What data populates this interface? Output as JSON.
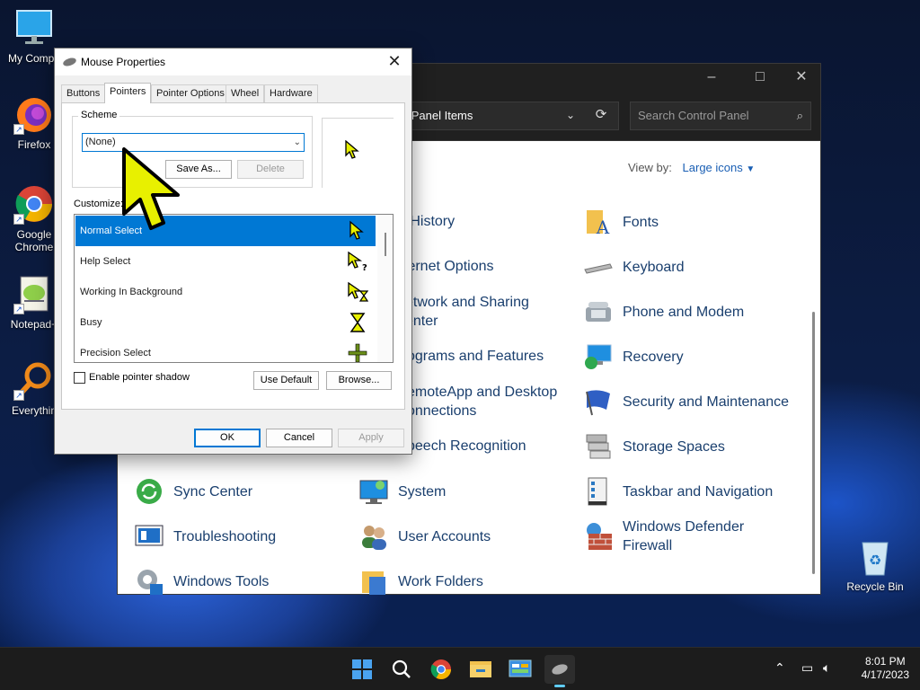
{
  "desktop": {
    "icons": [
      {
        "label": "My Compu"
      },
      {
        "label": "Firefox"
      },
      {
        "label": "Google"
      },
      {
        "label": "Chrome"
      },
      {
        "label": "Notepad+"
      },
      {
        "label": "Everythin"
      },
      {
        "label": "Recycle Bin"
      }
    ]
  },
  "control_panel": {
    "address": "ol Panel Items",
    "search_placeholder": "Search Control Panel",
    "view_by_label": "View by:",
    "view_by_value": "Large icons",
    "items": [
      {
        "label": "e History"
      },
      {
        "label": "Fonts"
      },
      {
        "label": "ternet Options"
      },
      {
        "label": "Keyboard"
      },
      {
        "label": "etwork and Sharing",
        "label2": "enter"
      },
      {
        "label": "Phone and Modem"
      },
      {
        "label": "ograms and Features"
      },
      {
        "label": "Recovery"
      },
      {
        "label": "emoteApp and Desktop",
        "label2": "onnections"
      },
      {
        "label": "Security and Maintenance"
      },
      {
        "label": "peech Recognition"
      },
      {
        "label": "Storage Spaces"
      },
      {
        "label": "Sync Center"
      },
      {
        "label": "System"
      },
      {
        "label": "Taskbar and Navigation"
      },
      {
        "label": "Troubleshooting"
      },
      {
        "label": "User Accounts"
      },
      {
        "label": "Windows Defender",
        "label2": "Firewall"
      },
      {
        "label": "Windows Tools"
      },
      {
        "label": "Work Folders"
      }
    ]
  },
  "dialog": {
    "title": "Mouse Properties",
    "tabs": [
      {
        "label": "Buttons"
      },
      {
        "label": "Pointers"
      },
      {
        "label": "Pointer Options"
      },
      {
        "label": "Wheel"
      },
      {
        "label": "Hardware"
      }
    ],
    "active_tab": "Pointers",
    "scheme_label": "Scheme",
    "scheme_value": "(None)",
    "save_as_label": "Save As...",
    "delete_label": "Delete",
    "customize_label": "Customize:",
    "pointers": [
      {
        "label": "Normal Select",
        "selected": true
      },
      {
        "label": "Help Select"
      },
      {
        "label": "Working In Background"
      },
      {
        "label": "Busy"
      },
      {
        "label": "Precision Select"
      }
    ],
    "shadow_label": "Enable pointer shadow",
    "shadow_checked": false,
    "use_default_label": "Use Default",
    "browse_label": "Browse...",
    "ok_label": "OK",
    "cancel_label": "Cancel",
    "apply_label": "Apply"
  },
  "taskbar": {
    "time": "8:01 PM",
    "date": "4/17/2023",
    "apps": [
      "start-icon",
      "search-icon",
      "chrome-icon",
      "file-explorer-icon",
      "control-panel-icon",
      "mouse-icon"
    ]
  },
  "colors": {
    "cursor_yellow": "#e8f000",
    "selection_blue": "#0078d4",
    "link_blue": "#1a3f6e"
  }
}
